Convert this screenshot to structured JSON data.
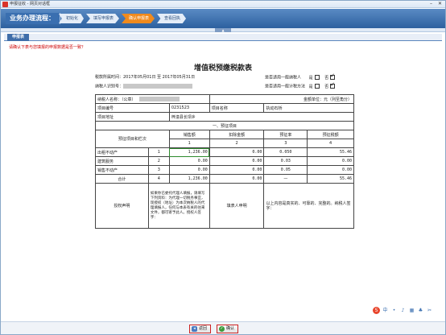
{
  "window": {
    "title": "申报征收 - 网页对话框"
  },
  "process": {
    "title": "业务办理流程：",
    "steps": [
      {
        "label": "初始化",
        "active": false
      },
      {
        "label": "填写申报表",
        "active": false
      },
      {
        "label": "确认申报表",
        "active": true
      },
      {
        "label": "查看回执",
        "active": false
      }
    ]
  },
  "tab": {
    "label": "申报表"
  },
  "notice": "请确认下表与您填报的申报数据是否一致？",
  "form": {
    "title": "增值税预缴税款表",
    "period_label": "税款所属时间：2017年05月01日  至 2017年05月31日",
    "taxpayer_id_label": "纳税人识别号：",
    "general_taxpayer_label": "是否适用一般计税方法",
    "consolidated_label": "是否适用一般纳税人",
    "yes": "是",
    "no": "否",
    "unit_label": "金额单位：元（列至角分）",
    "taxpayer_name_label": "纳税人名称：（公章）",
    "project_no_label": "项目编号",
    "project_no_value": "0231523",
    "project_name_label": "项目名称",
    "project_name_value": "执动石桥",
    "project_addr_label": "项目地址",
    "project_addr_value": "梓潼县长坝乡",
    "section_title": "一、预征项目",
    "col_item": "预征项目和栏次",
    "col_sales": "销售额",
    "col_deduct": "扣除金额",
    "col_rate": "预征率",
    "col_tax": "预征税额",
    "col_nums": [
      "1",
      "2",
      "3",
      "4"
    ],
    "rows": [
      {
        "name": "出租不动产",
        "no": "1",
        "sales": "1,236.00",
        "deduct": "0.00",
        "rate": "0.050",
        "tax": "55.46"
      },
      {
        "name": "建筑服务",
        "no": "2",
        "sales": "0.00",
        "deduct": "0.00",
        "rate": "0.03",
        "tax": "0.00"
      },
      {
        "name": "销售不动产",
        "no": "3",
        "sales": "0.00",
        "deduct": "0.00",
        "rate": "0.05",
        "tax": "0.00"
      },
      {
        "name": "合计",
        "no": "4",
        "sales": "1,236.00",
        "deduct": "0.00",
        "rate": "—",
        "tax": "55.46"
      }
    ],
    "declare_label": "授权声明",
    "declare_text": "如果你已委托代理人填报，请填写下列资料：为代理一切税务事宜，现授权（地址）为本次纳税人的代理填报人，任何与本表有关的往来文件，都可寄予此人。授权人签字：",
    "filler_label": "填表人申明",
    "statement_text": "以上内容是真实的、可靠的、完整的。纳税人签字："
  },
  "buttons": {
    "back": "返回",
    "confirm": "确认"
  },
  "colors": {
    "accent": "#3f6ea9",
    "active_step": "#f08a1c",
    "notice": "#cc0000"
  }
}
